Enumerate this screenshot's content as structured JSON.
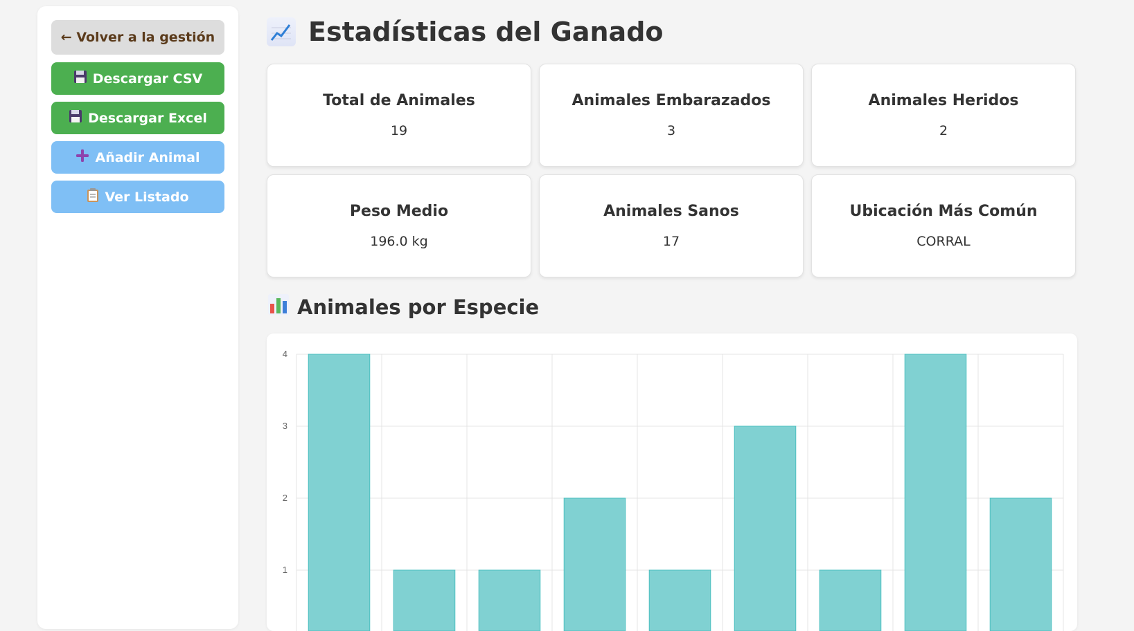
{
  "sidebar": {
    "back_label": "← Volver a la gestión",
    "csv_label": "Descargar CSV",
    "excel_label": "Descargar Excel",
    "add_label": "Añadir Animal",
    "list_label": "Ver Listado",
    "icons": {
      "csv": "floppy-disk-icon",
      "excel": "floppy-disk-icon",
      "add": "plus-icon",
      "list": "clipboard-icon"
    },
    "colors": {
      "back": "#dddddd",
      "green": "#4caf50",
      "blue": "#7fbff5"
    }
  },
  "header": {
    "title": "Estadísticas del Ganado",
    "icon": "chart-increasing-icon"
  },
  "stats": [
    {
      "label": "Total de Animales",
      "value": "19"
    },
    {
      "label": "Animales Embarazados",
      "value": "3"
    },
    {
      "label": "Animales Heridos",
      "value": "2"
    },
    {
      "label": "Peso Medio",
      "value": "196.0 kg"
    },
    {
      "label": "Animales Sanos",
      "value": "17"
    },
    {
      "label": "Ubicación Más Común",
      "value": "CORRAL"
    }
  ],
  "section": {
    "title": "Animales por Especie",
    "icon": "bar-chart-icon"
  },
  "chart_data": {
    "type": "bar",
    "title": "",
    "xlabel": "",
    "ylabel": "",
    "values": [
      4,
      1,
      1,
      2,
      1,
      3,
      1,
      4,
      2
    ],
    "y_ticks": [
      "1",
      "2",
      "3",
      "4"
    ],
    "ylim": [
      0,
      4
    ],
    "grid": true,
    "bar_color": "#80d1d2",
    "bar_border": "#4bc0c0"
  }
}
